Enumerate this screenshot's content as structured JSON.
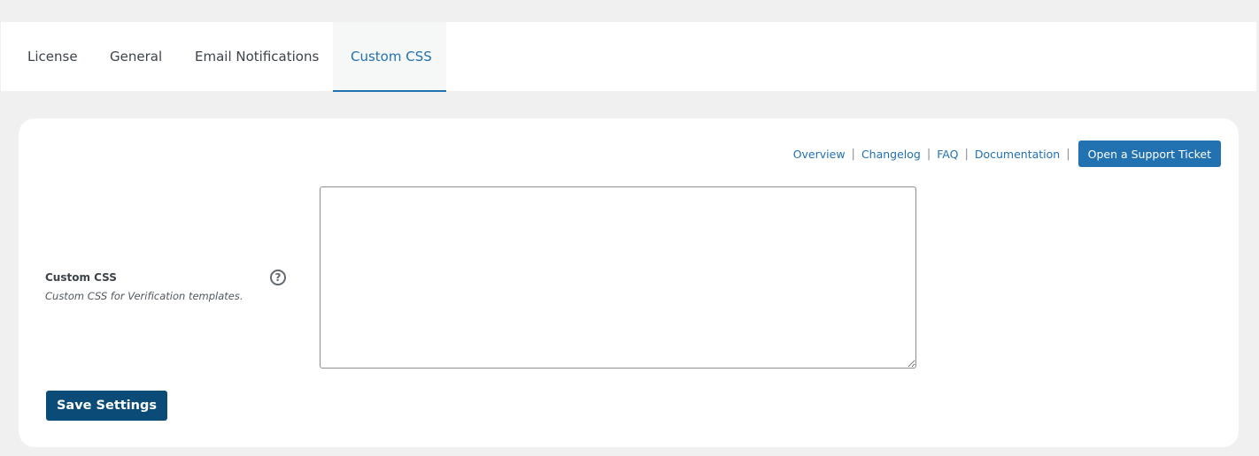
{
  "tabs": [
    {
      "label": "License",
      "active": false
    },
    {
      "label": "General",
      "active": false
    },
    {
      "label": "Email Notifications",
      "active": false
    },
    {
      "label": "Custom CSS",
      "active": true
    }
  ],
  "header_links": {
    "overview": "Overview",
    "changelog": "Changelog",
    "faq": "FAQ",
    "documentation": "Documentation",
    "separator": "|",
    "support_button": "Open a Support Ticket"
  },
  "field": {
    "label": "Custom CSS",
    "description": "Custom CSS for Verification templates.",
    "help_icon": "question-circle-icon",
    "help_glyph": "?",
    "value": "",
    "placeholder": ""
  },
  "actions": {
    "save_label": "Save Settings"
  },
  "colors": {
    "accent": "#2271b1",
    "save_button": "#0a4b78",
    "background": "#f0f0f1"
  }
}
